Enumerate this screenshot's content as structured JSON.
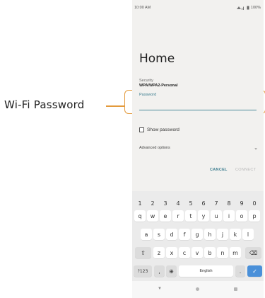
{
  "callout": {
    "label": "Wi-Fi Password",
    "color": "#e39a3c"
  },
  "status_bar": {
    "time": "10:00 AM",
    "signal_icon": "wifi-cell-signal-icon",
    "battery": "100%"
  },
  "network": {
    "name": "Home",
    "security_label": "Security",
    "security_value": "WPA/WPA2-Personal",
    "password_label": "Password",
    "password_value": ""
  },
  "options": {
    "show_password_label": "Show password",
    "show_password_checked": false,
    "advanced_label": "Advanced options"
  },
  "actions": {
    "cancel_label": "CANCEL",
    "connect_label": "CONNECT",
    "accent": "#3c7d8f",
    "disabled": "#b9b9b9"
  },
  "keyboard": {
    "numbers": [
      "1",
      "2",
      "3",
      "4",
      "5",
      "6",
      "7",
      "8",
      "9",
      "0"
    ],
    "row1": [
      "q",
      "w",
      "e",
      "r",
      "t",
      "y",
      "u",
      "i",
      "o",
      "p"
    ],
    "row2": [
      "a",
      "s",
      "d",
      "f",
      "g",
      "h",
      "j",
      "k",
      "l"
    ],
    "row3": [
      "z",
      "x",
      "c",
      "v",
      "b",
      "n",
      "m"
    ],
    "shift": "⇧",
    "backspace": "⌫",
    "symbols": "?123",
    "comma": ",",
    "globe": "⊕",
    "space": "English",
    "period": ".",
    "enter": "✓",
    "enter_color": "#4a90d9"
  },
  "nav": {
    "back_icon": "▼"
  }
}
